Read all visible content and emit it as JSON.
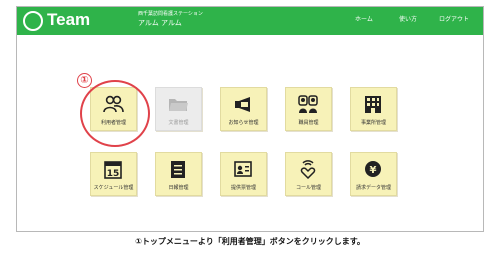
{
  "header": {
    "app_name": "Team",
    "station_name": "西千葉訪問看護ステーション",
    "user_name": "アルム アルム",
    "nav": [
      "ホーム",
      "使い方",
      "ログアウト"
    ]
  },
  "menu": {
    "tiles": [
      {
        "label": "利用者管理",
        "icon": "users-icon",
        "disabled": false
      },
      {
        "label": "文書管理",
        "icon": "folder-icon",
        "disabled": true
      },
      {
        "label": "お知らせ管理",
        "icon": "megaphone-icon",
        "disabled": false
      },
      {
        "label": "職員管理",
        "icon": "staff-icon",
        "disabled": false
      },
      {
        "label": "事業所管理",
        "icon": "building-icon",
        "disabled": false
      },
      {
        "label": "スケジュール管理",
        "icon": "calendar-icon",
        "disabled": false
      },
      {
        "label": "日報管理",
        "icon": "daily-report-icon",
        "disabled": false
      },
      {
        "label": "提供票管理",
        "icon": "service-slip-icon",
        "disabled": false
      },
      {
        "label": "コール管理",
        "icon": "call-icon",
        "disabled": false
      },
      {
        "label": "請求データ管理",
        "icon": "yen-icon",
        "disabled": false
      }
    ]
  },
  "annotation": {
    "step_number": "①",
    "caption": "①トップメニューより「利用者管理」ボタンをクリックします。",
    "color": "#e0424a"
  },
  "colors": {
    "header_green": "#2fb34a",
    "tile_yellow": "#f7f2b8",
    "tile_disabled": "#ececec"
  }
}
